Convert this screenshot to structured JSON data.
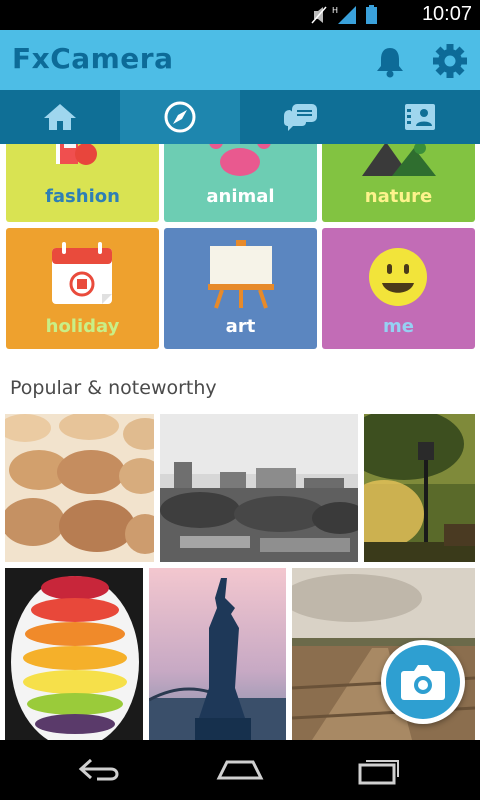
{
  "status_bar": {
    "time": "10:07"
  },
  "app": {
    "title": "FxCamera"
  },
  "header": {
    "bell_icon": "bell-icon",
    "settings_icon": "gear-icon"
  },
  "tabs": [
    {
      "icon": "home-icon",
      "active": false
    },
    {
      "icon": "compass-icon",
      "active": true
    },
    {
      "icon": "chat-icon",
      "active": false
    },
    {
      "icon": "contacts-icon",
      "active": false
    }
  ],
  "categories": [
    {
      "label": "fashion",
      "color": "#d9e352",
      "label_color": "#2e7fb5"
    },
    {
      "label": "animal",
      "color": "#6dcdb3",
      "label_color": "#ffffff"
    },
    {
      "label": "nature",
      "color": "#82c341",
      "label_color": "#fdf38c"
    },
    {
      "label": "holiday",
      "color": "#eea12e",
      "label_color": "#c9ef86"
    },
    {
      "label": "art",
      "color": "#5b86c0",
      "label_color": "#ffffff"
    },
    {
      "label": "me",
      "color": "#c26cb6",
      "label_color": "#95d1f3"
    }
  ],
  "section": {
    "title": "Popular & noteworthy"
  },
  "photos": [
    {
      "subject": "macarons"
    },
    {
      "subject": "city-skyline"
    },
    {
      "subject": "street-lamp-sunset"
    },
    {
      "subject": "fruit-platter"
    },
    {
      "subject": "statue-of-liberty"
    },
    {
      "subject": "field-road"
    }
  ],
  "fab": {
    "icon": "camera-icon"
  },
  "nav": {
    "back": "back-icon",
    "home": "home-nav-icon",
    "recents": "recents-icon"
  }
}
